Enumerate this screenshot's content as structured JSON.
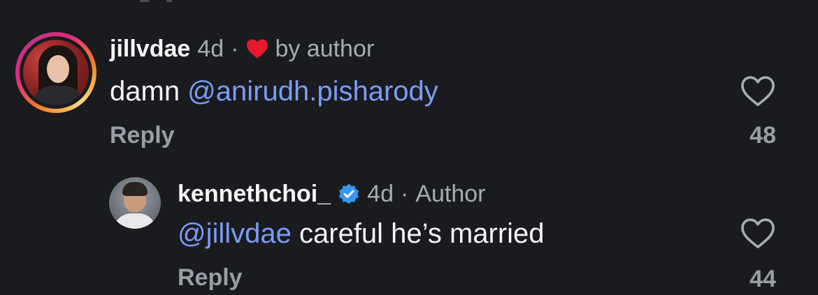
{
  "comments": [
    {
      "username": "jillvdae",
      "time": "4d",
      "separator": "·",
      "liked_by_author_label": "by author",
      "text_prefix": "damn ",
      "mention": "@anirudh.pisharody",
      "reply_label": "Reply",
      "like_count": "48",
      "heart_color": "#e8192c"
    },
    {
      "username": "kennethchoi_",
      "verified": true,
      "time": "4d",
      "separator": "·",
      "role_label": "Author",
      "mention": "@jillvdae",
      "text_suffix": " careful he’s married",
      "reply_label": "Reply",
      "like_count": "44",
      "verified_color": "#3897f0"
    }
  ],
  "colors": {
    "background": "#191b1f",
    "mention": "#7c9cf5",
    "muted": "#a8abb2"
  }
}
